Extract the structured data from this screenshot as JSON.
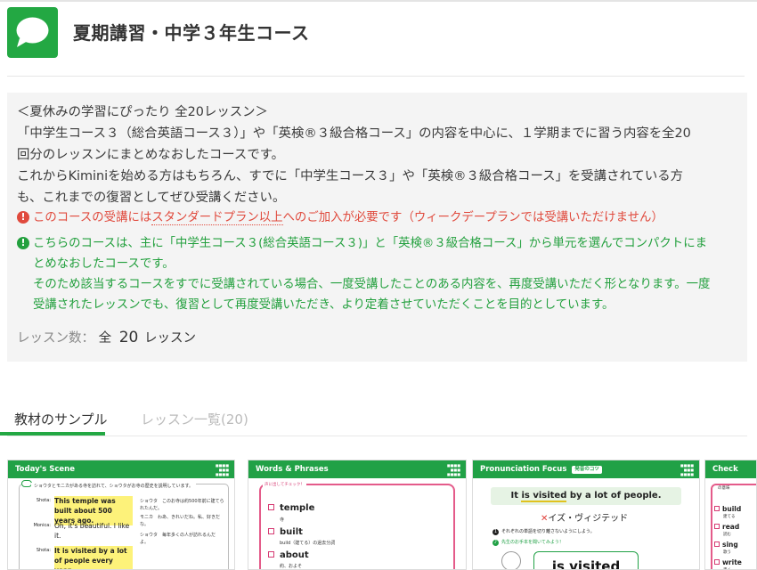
{
  "header": {
    "title": "夏期講習・中学３年生コース",
    "logo_icon": "chat-bubble-icon",
    "brand_color": "#23a843"
  },
  "info": {
    "description": [
      "＜夏休みの学習にぴったり 全20レッスン＞",
      "「中学生コース３（総合英語コース３）」や「英検®３級合格コース」の内容を中心に、１学期までに習う内容を全20",
      "回分のレッスンにまとめなおしたコースです。",
      "これからKiminiを始める方はもちろん、すでに「中学生コース３」や「英検®３級合格コース」を受講されている方",
      "も、これまでの復習としてぜひ受講ください。"
    ],
    "plan_notice": {
      "icon": "exclamation-icon",
      "before": "このコースの受講には",
      "underlined": "スタンダードプラン以上",
      "after": "へのご加入が必要です（ウィークデープランでは受講いただけません）",
      "color": "#e04a3d"
    },
    "scope_notice": {
      "icon": "exclamation-icon",
      "lines": [
        "こちらのコースは、主に「中学生コース３(総合英語コース３)」と「英検®３級合格コース」から単元を選んでコンパクトにま",
        "とめなおしたコースです。",
        "そのため該当するコースをすでに受講されている場合、一度受講したことのある内容を、再度受講いただく形となります。一度",
        "受講されたレッスンでも、復習として再度受講いただき、より定着させていただくことを目的としています。"
      ],
      "color": "#23a03e"
    },
    "lesson_count": {
      "label": "レッスン数：",
      "prefix": "全",
      "number": "20",
      "unit": "レッスン"
    }
  },
  "tabs": [
    {
      "label": "教材のサンプル",
      "active": true
    },
    {
      "label": "レッスン一覧(20)",
      "active": false
    }
  ],
  "samples": {
    "todays_scene": {
      "title": "Today's Scene",
      "caption": "ショウタとモニカがある寺を訪れて、ショウタがお寺の歴史を説明しています。",
      "lines": [
        {
          "speaker": "Shota:",
          "text": "This temple was built about 500 years ago.",
          "highlight": true
        },
        {
          "speaker": "Monica:",
          "text": "Oh, it's beautiful. I like it.",
          "highlight": false
        },
        {
          "speaker": "Shota:",
          "text": "It is visited by a lot of people every year.",
          "highlight": true
        }
      ],
      "translations": [
        {
          "speaker": "ショウタ",
          "text": "このお寺は約500年前に建てられたんだ。"
        },
        {
          "speaker": "モニカ",
          "text": "わあ、きれいだね。私、好きだな。"
        },
        {
          "speaker": "ショウタ",
          "text": "毎年多くの人が訪れるんだよ。"
        }
      ]
    },
    "words_phrases": {
      "title": "Words & Phrases",
      "tag": "声に出してチェック！",
      "items": [
        {
          "word": "temple",
          "meaning": "寺"
        },
        {
          "word": "built",
          "meaning": "build（建てる）の過去分詞"
        },
        {
          "word": "about",
          "meaning": "約、およそ"
        }
      ]
    },
    "pronunciation_focus": {
      "title": "Pronunciation Focus",
      "tag": "発音のコツ",
      "sentence_before": "It ",
      "sentence_underlined": "is visited",
      "sentence_after": " by a lot of people.",
      "wrong_mark": "✕",
      "wrong_reading": "イズ・ヴィジテッド",
      "note1": "それぞれの単語を切り離さないようにしよう。",
      "note2": "先生のお手本を聞いてみよう！",
      "speech": "is visited"
    },
    "check": {
      "title": "Check",
      "tag": "の意味",
      "items": [
        {
          "word": "build",
          "meaning": "建てる"
        },
        {
          "word": "read",
          "meaning": "読む"
        },
        {
          "word": "sing",
          "meaning": "歌う"
        },
        {
          "word": "write",
          "meaning": "書く"
        }
      ]
    }
  }
}
